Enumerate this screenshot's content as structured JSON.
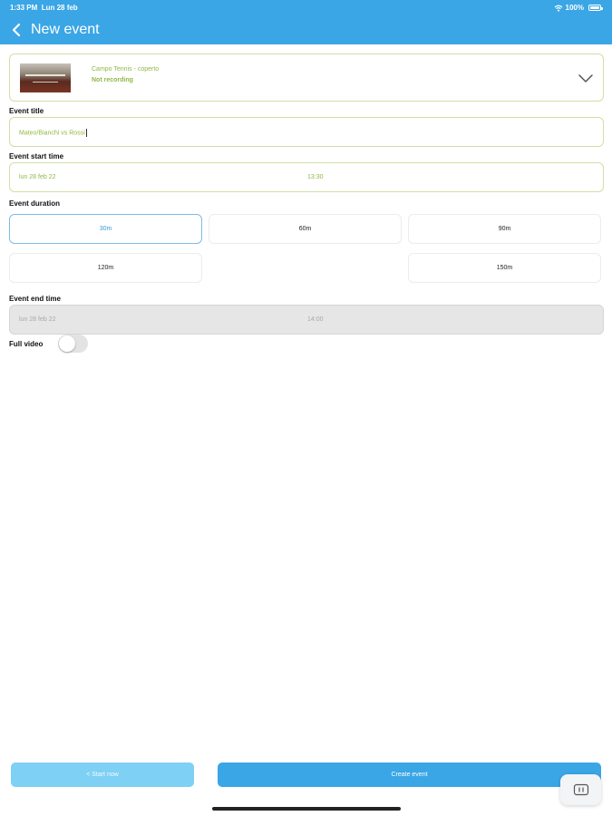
{
  "status_bar": {
    "time": "1:33 PM",
    "date": "Lun 28 feb",
    "battery": "100%",
    "icons": [
      "wifi-icon",
      "battery-icon"
    ]
  },
  "header": {
    "title": "New event",
    "back_icon": "chevron-left-icon"
  },
  "camera": {
    "name": "Campo Tennis - coperto",
    "status": "Not recording",
    "dropdown_icon": "chevron-down-icon"
  },
  "event_title": {
    "label": "Event title",
    "value": "Mateo/Bianchi vs Rossi"
  },
  "start_time": {
    "label": "Event start time",
    "date": "lun 28 feb 22",
    "time": "13:30"
  },
  "duration": {
    "label": "Event duration",
    "options": [
      "30m",
      "60m",
      "90m",
      "120m",
      "150m"
    ],
    "selected": "30m"
  },
  "end_time": {
    "label": "Event end time",
    "date": "lun 28 feb 22",
    "time": "14:00"
  },
  "full_video": {
    "label": "Full video",
    "enabled": false
  },
  "buttons": {
    "start_now": "< Start now",
    "create_event": "Create event"
  },
  "colors": {
    "accent": "#3aa6e6",
    "green": "#8fb945",
    "field_border": "#cfe0a5",
    "disabled_bg": "#e6e6e6"
  }
}
